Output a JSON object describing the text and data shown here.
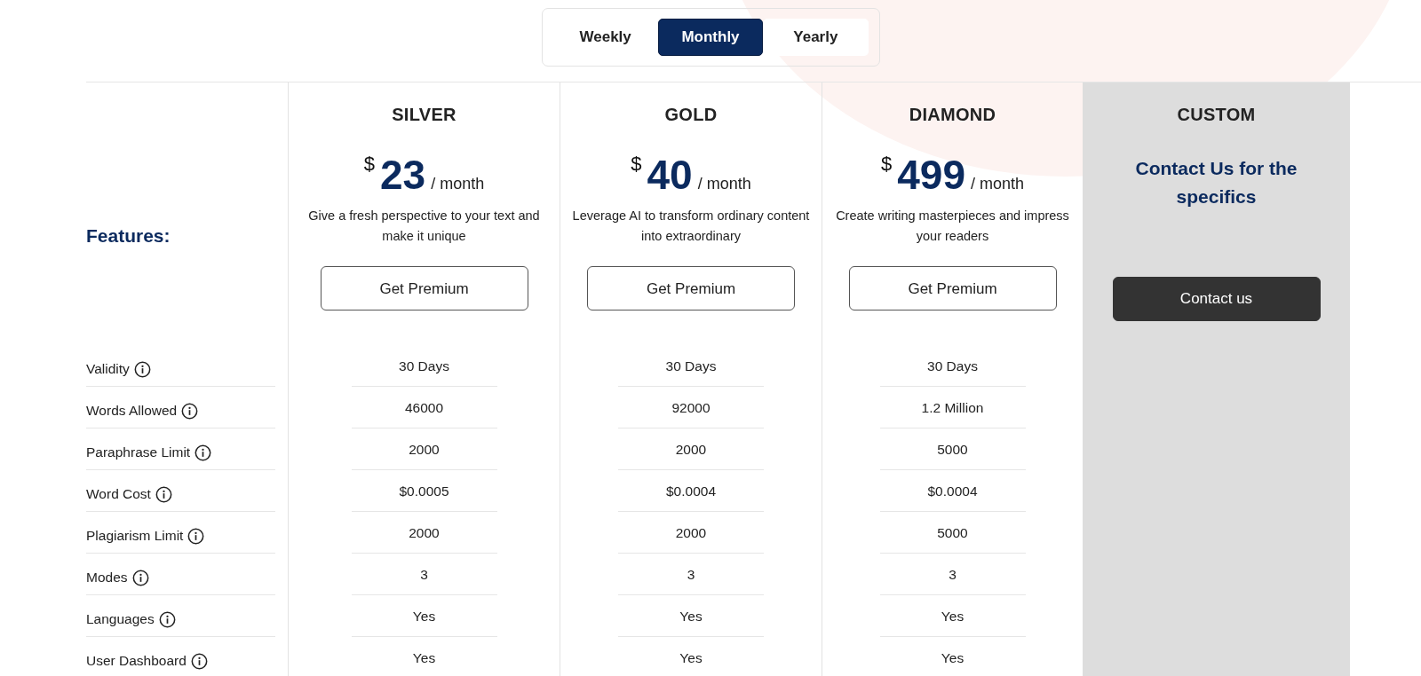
{
  "billing_toggle": [
    {
      "label": "Weekly",
      "selected": false
    },
    {
      "label": "Monthly",
      "selected": true
    },
    {
      "label": "Yearly",
      "selected": false
    }
  ],
  "features_heading": "Features:",
  "features": [
    "Validity",
    "Words Allowed",
    "Paraphrase Limit",
    "Word Cost",
    "Plagiarism Limit",
    "Modes",
    "Languages",
    "User Dashboard"
  ],
  "plans": [
    {
      "kind": "priced",
      "name": "SILVER",
      "currency": "$",
      "price": "23",
      "period": "/ month",
      "description": "Give a fresh perspective to your text and make it unique",
      "button": "Get Premium",
      "values": [
        "30 Days",
        "46000",
        "2000",
        "$0.0005",
        "2000",
        "3",
        "Yes",
        "Yes"
      ]
    },
    {
      "kind": "priced",
      "name": "GOLD",
      "currency": "$",
      "price": "40",
      "period": "/ month",
      "description": "Leverage AI to transform ordinary content into extraordinary",
      "button": "Get Premium",
      "values": [
        "30 Days",
        "92000",
        "2000",
        "$0.0004",
        "2000",
        "3",
        "Yes",
        "Yes"
      ]
    },
    {
      "kind": "priced",
      "name": "DIAMOND",
      "currency": "$",
      "price": "499",
      "period": "/ month",
      "description": "Create writing masterpieces and impress your readers",
      "button": "Get Premium",
      "values": [
        "30 Days",
        "1.2 Million",
        "5000",
        "$0.0004",
        "5000",
        "3",
        "Yes",
        "Yes"
      ]
    },
    {
      "kind": "custom",
      "name": "CUSTOM",
      "note": "Contact Us for the specifics",
      "button": "Contact us"
    }
  ]
}
